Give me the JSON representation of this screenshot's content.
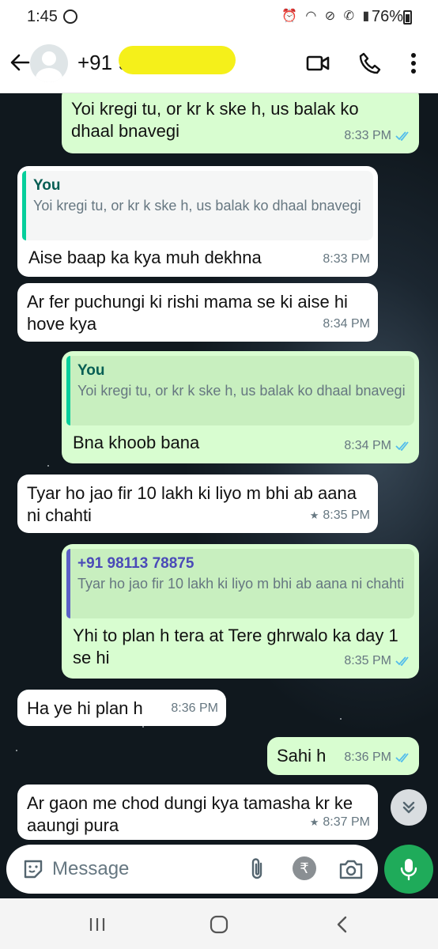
{
  "status_bar": {
    "time": "1:45",
    "battery": "76%"
  },
  "header": {
    "contact": "+91 98"
  },
  "messages": [
    {
      "dir": "out",
      "text": "Yoi kregi tu, or kr k ske h, us balak ko dhaal bnavegi",
      "time": "8:33 PM",
      "ticks": "read"
    },
    {
      "dir": "in",
      "quote_name": "You",
      "quote_text": "Yoi kregi tu, or kr k ske h, us balak ko dhaal bnavegi",
      "text": "Aise baap ka kya muh dekhna",
      "time": "8:33 PM"
    },
    {
      "dir": "in",
      "text": "Ar fer puchungi ki rishi mama se ki aise hi hove kya",
      "time": "8:34 PM"
    },
    {
      "dir": "out",
      "quote_name": "You",
      "quote_text": "Yoi kregi tu, or kr k ske h, us balak ko dhaal bnavegi",
      "text": "Bna khoob bana",
      "time": "8:34 PM",
      "ticks": "read"
    },
    {
      "dir": "in",
      "text": "Tyar ho jao fir 10 lakh ki liyo m bhi ab aana ni chahti",
      "time": "8:35 PM",
      "starred": true
    },
    {
      "dir": "out",
      "quote_name": "+91 98113 78875",
      "quote_text": "Tyar ho jao fir 10 lakh ki liyo m bhi ab aana ni chahti",
      "text": "Yhi to plan h tera at Tere ghrwalo ka day 1 se hi",
      "time": "8:35 PM",
      "ticks": "read"
    },
    {
      "dir": "in",
      "text": "Ha ye hi plan h",
      "time": "8:36 PM"
    },
    {
      "dir": "out",
      "text": "Sahi h",
      "time": "8:36 PM",
      "ticks": "read"
    },
    {
      "dir": "in",
      "text": "Ar gaon me chod dungi kya tamasha kr ke aaungi pura",
      "time": "8:37 PM",
      "starred": true
    }
  ],
  "input": {
    "placeholder": "Message"
  },
  "icons": {
    "back": "arrow-left-icon",
    "video": "video-camera-icon",
    "call": "phone-icon",
    "menu": "more-vert-icon",
    "emoji": "sticker-icon",
    "attach": "paperclip-icon",
    "payment": "rupee-icon",
    "camera": "camera-icon",
    "mic": "microphone-icon",
    "scroll": "double-chevron-down-icon",
    "tick": "double-check-icon",
    "star": "star-icon"
  },
  "colors": {
    "outgoing_bubble": "#d8fdd0",
    "incoming_bubble": "#ffffff",
    "read_tick": "#53bdeb",
    "quote_you": "#075e54",
    "quote_contact": "#4a4ab8",
    "mic_button": "#1fab5a",
    "redaction": "#f5f01a"
  }
}
